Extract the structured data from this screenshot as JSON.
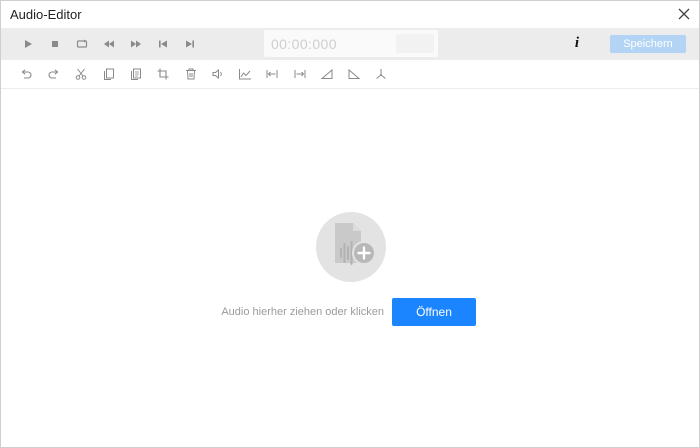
{
  "window": {
    "title": "Audio-Editor",
    "close_icon": "close-icon"
  },
  "transport": {
    "buttons": [
      {
        "name": "play",
        "icon": "play-icon"
      },
      {
        "name": "stop",
        "icon": "stop-icon"
      },
      {
        "name": "loop",
        "icon": "loop-icon"
      },
      {
        "name": "rewind",
        "icon": "rewind-icon"
      },
      {
        "name": "fast-forward",
        "icon": "fast-forward-icon"
      },
      {
        "name": "skip-to-start",
        "icon": "skip-start-icon"
      },
      {
        "name": "skip-to-end",
        "icon": "skip-end-icon"
      }
    ],
    "timecode": "00:00:000",
    "info_label": "i",
    "save_label": "Speichern"
  },
  "edit_toolbar": {
    "buttons": [
      {
        "name": "undo",
        "icon": "undo-icon"
      },
      {
        "name": "redo",
        "icon": "redo-icon"
      },
      {
        "name": "cut",
        "icon": "scissors-icon"
      },
      {
        "name": "copy",
        "icon": "copy-icon"
      },
      {
        "name": "paste",
        "icon": "paste-icon"
      },
      {
        "name": "crop",
        "icon": "crop-icon"
      },
      {
        "name": "delete",
        "icon": "trash-icon"
      },
      {
        "name": "volume",
        "icon": "volume-icon"
      },
      {
        "name": "amplify",
        "icon": "waveform-chart-icon"
      },
      {
        "name": "trim-start",
        "icon": "trim-start-icon"
      },
      {
        "name": "trim-end",
        "icon": "trim-end-icon"
      },
      {
        "name": "fade-in",
        "icon": "fade-in-icon"
      },
      {
        "name": "fade-out",
        "icon": "fade-out-icon"
      },
      {
        "name": "split",
        "icon": "split-icon"
      }
    ]
  },
  "dropzone": {
    "icon": "audio-file-add-icon",
    "hint": "Audio hierher ziehen oder klicken",
    "open_label": "Öffnen"
  },
  "colors": {
    "accent": "#1a85ff",
    "save_disabled": "#b3d4f5",
    "toolbar_bg": "#ececec",
    "icon_gray": "#8a8a8a"
  }
}
